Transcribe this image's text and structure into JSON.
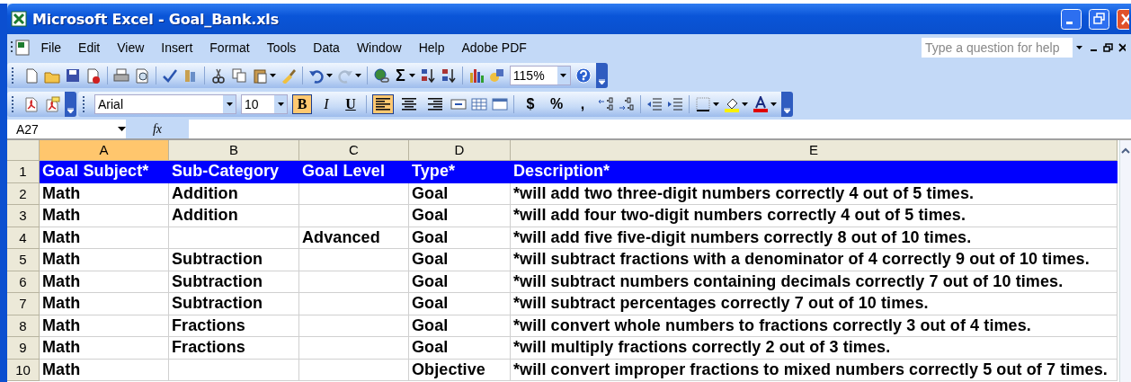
{
  "window": {
    "title": "Microsoft Excel - Goal_Bank.xls"
  },
  "menu": [
    "File",
    "Edit",
    "View",
    "Insert",
    "Format",
    "Tools",
    "Data",
    "Window",
    "Help",
    "Adobe PDF"
  ],
  "help_search": {
    "placeholder": "Type a question for help"
  },
  "standard_toolbar": {
    "sum_symbol": "Σ",
    "zoom": "115%"
  },
  "formatting_toolbar": {
    "font": "Arial",
    "size": "10",
    "styles": [
      {
        "label": "B",
        "selected": true
      },
      {
        "label": "I",
        "selected": false
      },
      {
        "label": "U",
        "selected": false
      }
    ],
    "alignment": [
      {
        "kind": "left",
        "selected": true
      },
      {
        "kind": "center",
        "selected": false
      },
      {
        "kind": "right",
        "selected": false
      }
    ],
    "number_formats": [
      "$",
      "%",
      ","
    ]
  },
  "formula_bar": {
    "name_box": "A27",
    "function_symbol": "fx"
  },
  "sheet": {
    "columns": [
      {
        "label": "A",
        "selected": true
      },
      {
        "label": "B",
        "selected": false
      },
      {
        "label": "C",
        "selected": false
      },
      {
        "label": "D",
        "selected": false
      },
      {
        "label": "E",
        "selected": false
      }
    ],
    "rows": [
      {
        "number": "1",
        "header": true,
        "cells": [
          "Goal Subject*",
          "Sub-Category",
          "Goal Level",
          "Type*",
          "Description*"
        ]
      },
      {
        "number": "2",
        "header": false,
        "cells": [
          "Math",
          "Addition",
          "",
          "Goal",
          "*will add two three-digit numbers correctly 4 out of 5 times."
        ]
      },
      {
        "number": "3",
        "header": false,
        "cells": [
          "Math",
          "Addition",
          "",
          "Goal",
          "*will add four two-digit numbers correctly 4 out of 5 times."
        ]
      },
      {
        "number": "4",
        "header": false,
        "cells": [
          "Math",
          "",
          "Advanced",
          "Goal",
          "*will add five five-digit numbers correctly 8 out of 10 times."
        ]
      },
      {
        "number": "5",
        "header": false,
        "cells": [
          "Math",
          "Subtraction",
          "",
          "Goal",
          "*will subtract fractions with a denominator of 4 correctly 9 out of 10 times."
        ]
      },
      {
        "number": "6",
        "header": false,
        "cells": [
          "Math",
          "Subtraction",
          "",
          "Goal",
          "*will subtract numbers containing decimals correctly 7 out of 10 times."
        ]
      },
      {
        "number": "7",
        "header": false,
        "cells": [
          "Math",
          "Subtraction",
          "",
          "Goal",
          "*will subtract percentages correctly 7 out of 10 times."
        ]
      },
      {
        "number": "8",
        "header": false,
        "cells": [
          "Math",
          "Fractions",
          "",
          "Goal",
          "*will convert whole numbers to fractions correctly 3 out of 4 times."
        ]
      },
      {
        "number": "9",
        "header": false,
        "cells": [
          "Math",
          "Fractions",
          "",
          "Goal",
          "*will multiply fractions correctly 2 out of 3 times."
        ]
      },
      {
        "number": "10",
        "header": false,
        "cells": [
          "Math",
          "",
          "",
          "Objective",
          "*will convert improper fractions to mixed numbers correctly 5 out of 7 times."
        ]
      }
    ]
  }
}
